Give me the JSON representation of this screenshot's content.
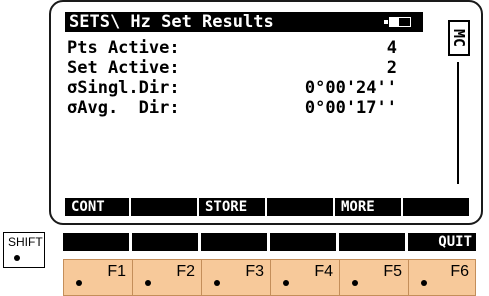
{
  "screen": {
    "title": "SETS\\  Hz Set Results",
    "side_label": "MC",
    "rows": [
      {
        "label": "Pts Active:",
        "value": "4"
      },
      {
        "label": "Set Active:",
        "value": "2"
      },
      {
        "label": "σSingl.Dir:",
        "value": "0°00'24''"
      },
      {
        "label": "σAvg.  Dir:",
        "value": "0°00'17''"
      }
    ],
    "softkeys": [
      "CONT",
      "",
      "STORE",
      "",
      "MORE",
      ""
    ]
  },
  "keys": {
    "shift_label": "SHIFT",
    "shift_bar_labels": [
      "",
      "",
      "",
      "",
      "",
      "QUIT"
    ],
    "function_keys": [
      "F1",
      "F2",
      "F3",
      "F4",
      "F5",
      "F6"
    ]
  },
  "battery_icon": "battery-icon"
}
